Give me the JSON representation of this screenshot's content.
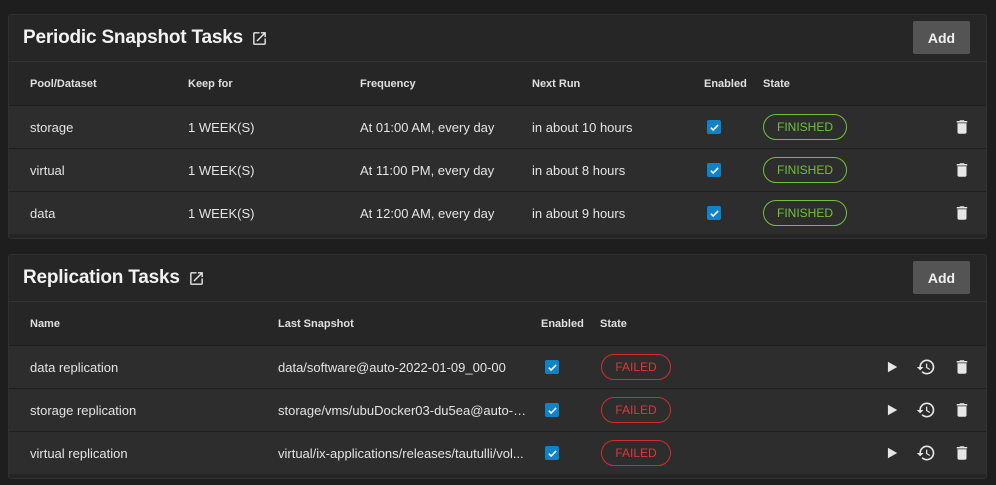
{
  "snapshot": {
    "title": "Periodic Snapshot Tasks",
    "add_label": "Add",
    "columns": {
      "pool": "Pool/Dataset",
      "keep": "Keep for",
      "freq": "Frequency",
      "next": "Next Run",
      "enabled": "Enabled",
      "state": "State"
    },
    "rows": [
      {
        "pool": "storage",
        "keep": "1 WEEK(S)",
        "freq": "At 01:00 AM, every day",
        "next": "in about 10 hours",
        "enabled": true,
        "state": "FINISHED"
      },
      {
        "pool": "virtual",
        "keep": "1 WEEK(S)",
        "freq": "At 11:00 PM, every day",
        "next": "in about 8 hours",
        "enabled": true,
        "state": "FINISHED"
      },
      {
        "pool": "data",
        "keep": "1 WEEK(S)",
        "freq": "At 12:00 AM, every day",
        "next": "in about 9 hours",
        "enabled": true,
        "state": "FINISHED"
      }
    ]
  },
  "replication": {
    "title": "Replication Tasks",
    "add_label": "Add",
    "columns": {
      "name": "Name",
      "last": "Last Snapshot",
      "enabled": "Enabled",
      "state": "State"
    },
    "rows": [
      {
        "name": "data replication",
        "last": "data/software@auto-2022-01-09_00-00",
        "enabled": true,
        "state": "FAILED"
      },
      {
        "name": "storage replication",
        "last": "storage/vms/ubuDocker03-du5ea@auto-2...",
        "enabled": true,
        "state": "FAILED"
      },
      {
        "name": "virtual replication",
        "last": "virtual/ix-applications/releases/tautulli/vol...",
        "enabled": true,
        "state": "FAILED"
      }
    ]
  },
  "colors": {
    "background": "#1e1e1e",
    "card": "#262626",
    "row": "#2d2d2d",
    "checkbox": "#0f83c8",
    "finished": "#72c13a",
    "failed": "#d22d2d",
    "add_button": "#545454"
  },
  "icons": {
    "external": "open-in-new-icon",
    "delete": "trash-icon",
    "run": "play-icon",
    "restore": "history-icon",
    "check": "check-icon"
  }
}
